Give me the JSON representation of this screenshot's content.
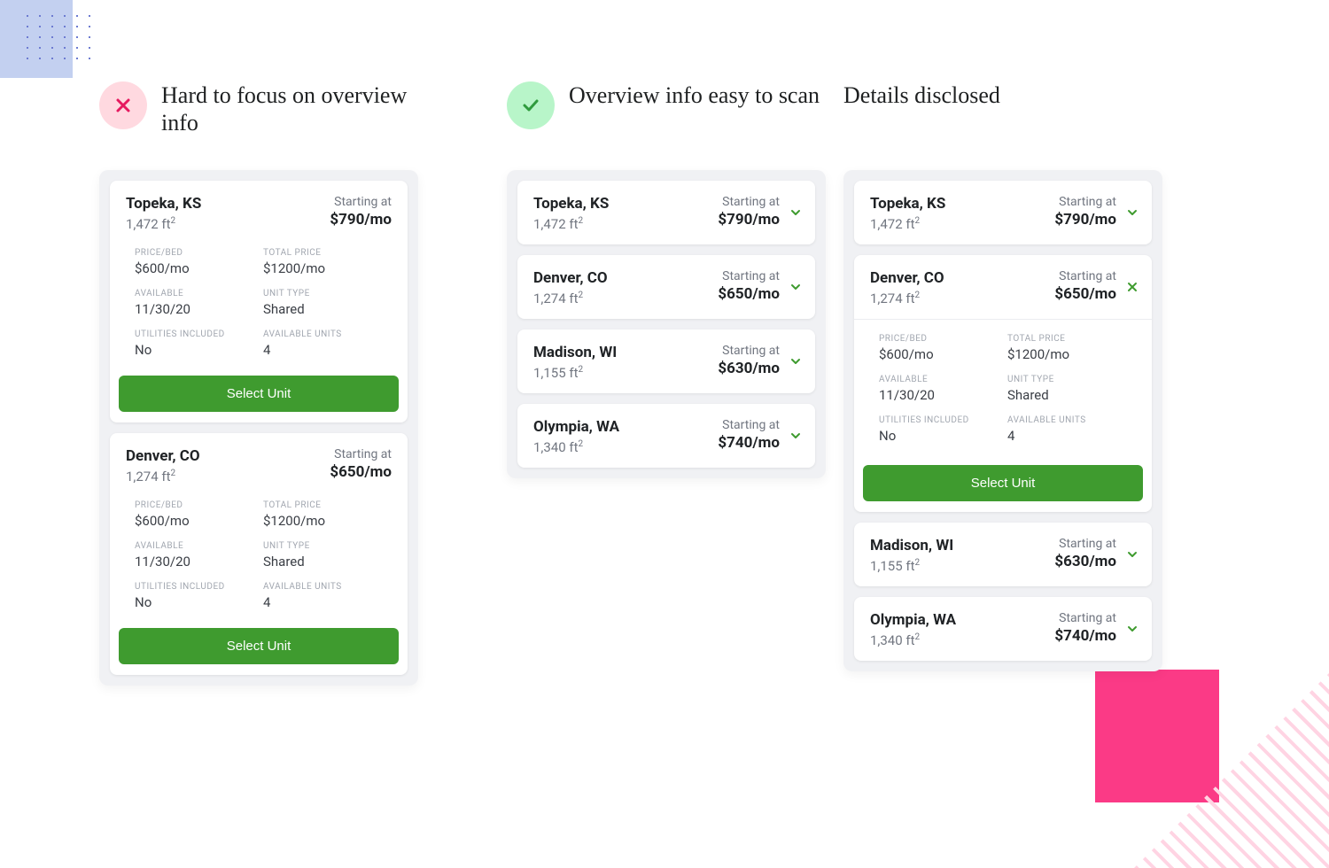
{
  "headings": {
    "bad": "Hard to focus on overview info",
    "good": "Overview info easy to scan",
    "disclosed": "Details disclosed"
  },
  "labels": {
    "starting_at": "Starting at",
    "price_bed": "PRICE/BED",
    "total_price": "TOTAL PRICE",
    "available": "AVAILABLE",
    "unit_type": "UNIT TYPE",
    "utilities": "UTILITIES INCLUDED",
    "avail_units": "AVAILABLE UNITS",
    "select_unit": "Select Unit"
  },
  "listings": [
    {
      "loc": "Topeka, KS",
      "area": "1,472 ft²",
      "price": "$790/mo"
    },
    {
      "loc": "Denver, CO",
      "area": "1,274 ft²",
      "price": "$650/mo"
    },
    {
      "loc": "Madison, WI",
      "area": "1,155 ft²",
      "price": "$630/mo"
    },
    {
      "loc": "Olympia, WA",
      "area": "1,340 ft²",
      "price": "$740/mo"
    }
  ],
  "details": {
    "price_bed": "$600/mo",
    "total_price": "$1200/mo",
    "available": "11/30/20",
    "unit_type": "Shared",
    "utilities": "No",
    "avail_units": "4"
  },
  "icons": {
    "cross_color": "#e6195f",
    "check_color": "#2f9b3d",
    "chev_color": "#3f9b2f"
  }
}
